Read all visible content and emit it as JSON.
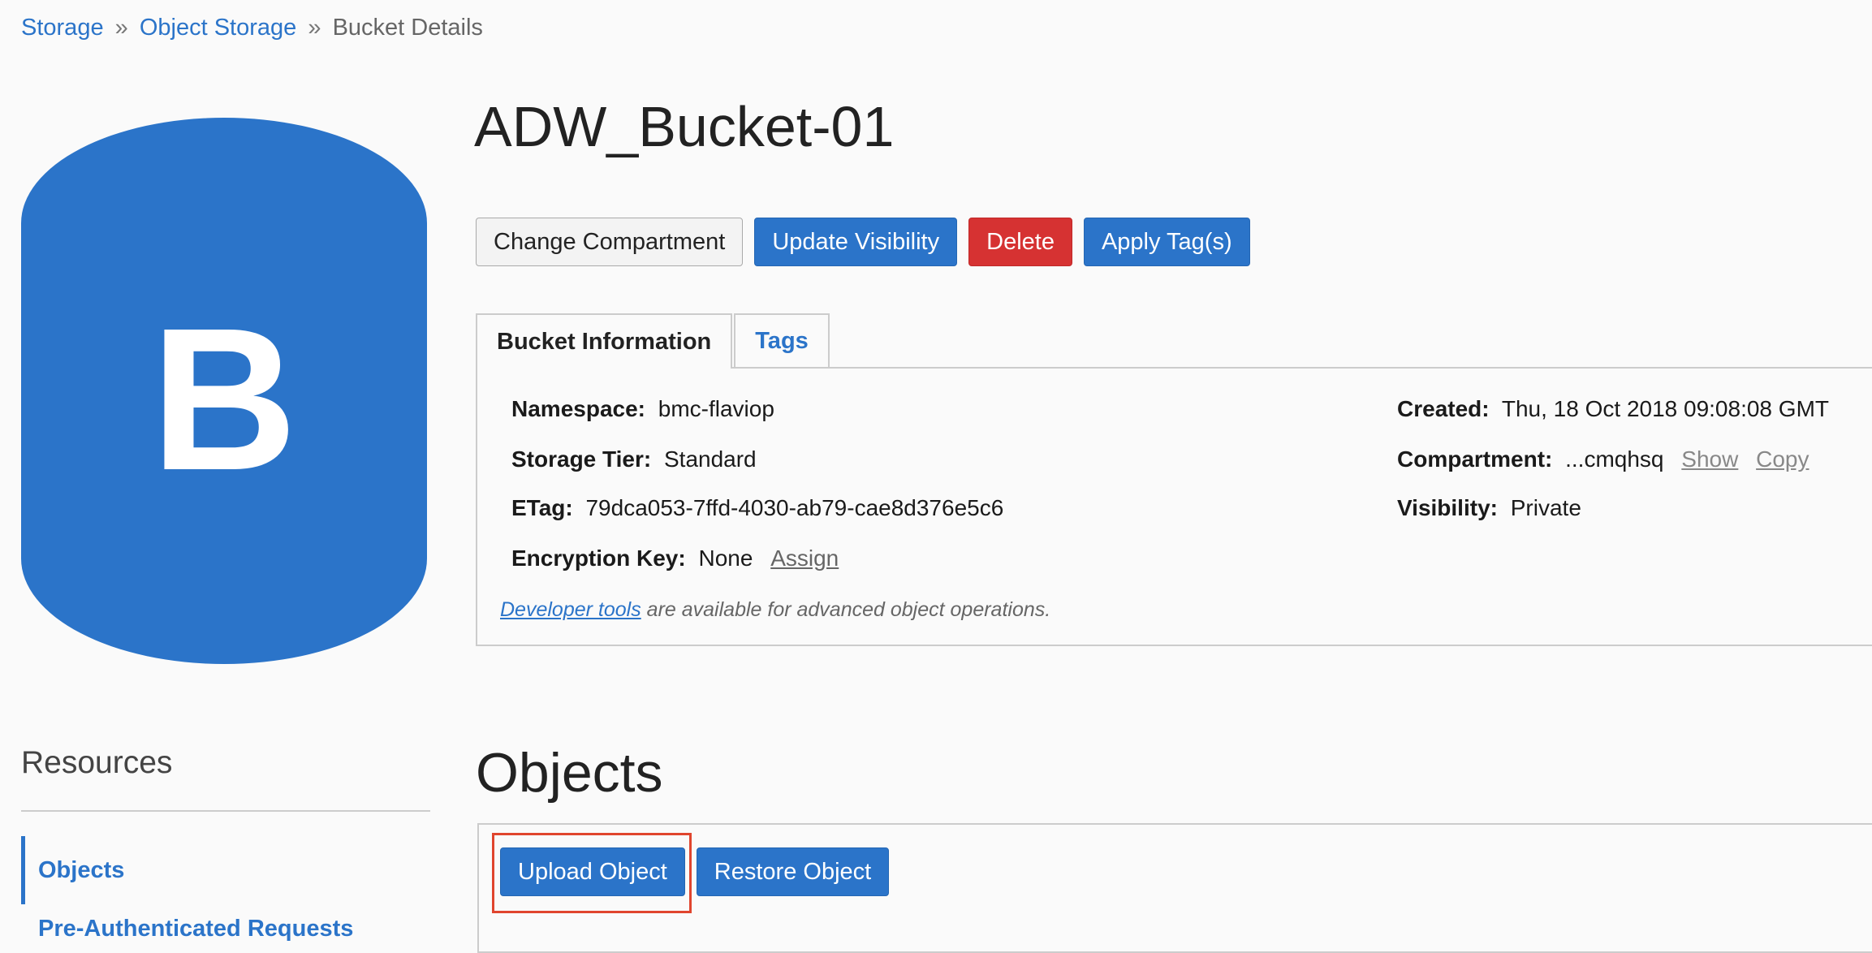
{
  "breadcrumb": {
    "items": [
      "Storage",
      "Object Storage",
      "Bucket Details"
    ],
    "separator": "»"
  },
  "bucket_icon": {
    "letter": "B",
    "color": "#2b74c9"
  },
  "bucket": {
    "name": "ADW_Bucket-01"
  },
  "actions": {
    "change_compartment": "Change Compartment",
    "update_visibility": "Update Visibility",
    "delete": "Delete",
    "apply_tags": "Apply Tag(s)"
  },
  "tabs": [
    {
      "label": "Bucket Information",
      "active": true
    },
    {
      "label": "Tags",
      "active": false
    }
  ],
  "info": {
    "namespace": {
      "label": "Namespace:",
      "value": "bmc-flaviop"
    },
    "storage_tier": {
      "label": "Storage Tier:",
      "value": "Standard"
    },
    "etag": {
      "label": "ETag:",
      "value": "79dca053-7ffd-4030-ab79-cae8d376e5c6"
    },
    "encryption_key": {
      "label": "Encryption Key:",
      "value": "None",
      "action": "Assign"
    },
    "created": {
      "label": "Created:",
      "value": "Thu, 18 Oct 2018 09:08:08 GMT"
    },
    "compartment": {
      "label": "Compartment:",
      "value": "...cmqhsq",
      "show": "Show",
      "copy": "Copy"
    },
    "visibility": {
      "label": "Visibility:",
      "value": "Private"
    },
    "dev_note": {
      "link": "Developer tools",
      "text": " are available for advanced object operations."
    }
  },
  "resources": {
    "title": "Resources",
    "items": [
      "Objects",
      "Pre-Authenticated Requests"
    ]
  },
  "objects": {
    "title": "Objects",
    "upload": "Upload Object",
    "restore": "Restore Object"
  },
  "colors": {
    "primary": "#2b74c9",
    "danger": "#d63232",
    "highlight": "#e0452e"
  }
}
